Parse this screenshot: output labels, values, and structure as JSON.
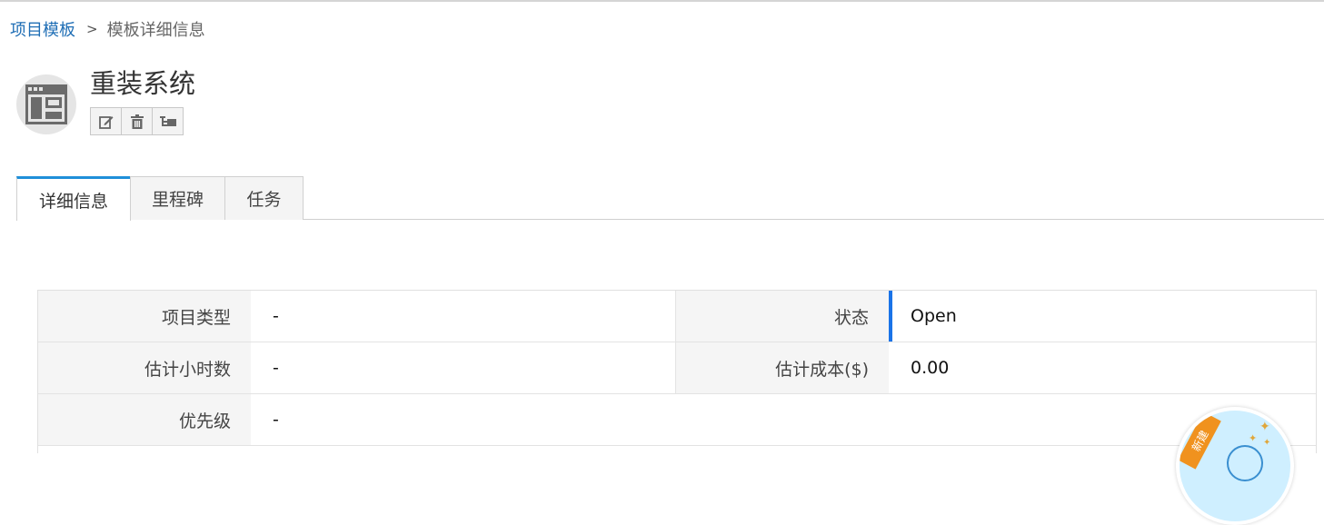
{
  "breadcrumb": {
    "root": "项目模板",
    "separator": ">",
    "current": "模板详细信息"
  },
  "header": {
    "title": "重装系统",
    "icon": "template-window-icon",
    "tools": [
      {
        "name": "edit-icon"
      },
      {
        "name": "trash-icon"
      },
      {
        "name": "hierarchy-icon"
      }
    ]
  },
  "tabs": [
    {
      "label": "详细信息",
      "active": true
    },
    {
      "label": "里程碑",
      "active": false
    },
    {
      "label": "任务",
      "active": false
    }
  ],
  "details": {
    "project_type_label": "项目类型",
    "project_type_value": "-",
    "status_label": "状态",
    "status_value": "Open",
    "est_hours_label": "估计小时数",
    "est_hours_value": "-",
    "est_cost_label": "估计成本($)",
    "est_cost_value": "0.00",
    "priority_label": "优先级",
    "priority_value": "-"
  },
  "float_badge": {
    "ribbon": "新建"
  },
  "colors": {
    "link": "#1f6eb5",
    "active_tab_accent": "#1f8fd9",
    "status_accent": "#1a73e8",
    "badge_ribbon": "#f0921e"
  }
}
